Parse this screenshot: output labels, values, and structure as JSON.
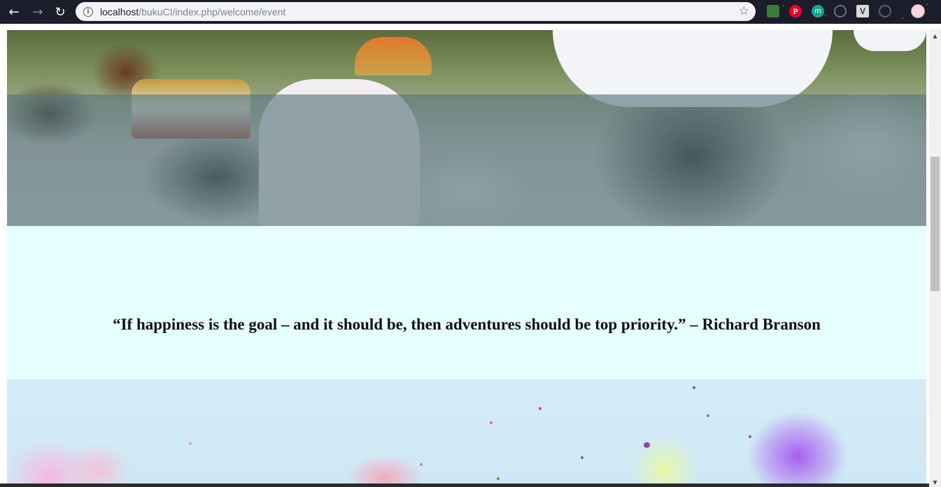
{
  "browser": {
    "url_host": "localhost",
    "url_path": "/bukuCI/index.php/welcome/event",
    "icons": {
      "back": "arrow-left-icon",
      "forward": "arrow-right-icon",
      "reload": "reload-icon",
      "site_info": "info-icon",
      "bookmark": "star-icon"
    },
    "extensions": {
      "pinterest_label": "P",
      "m_label": "m",
      "v_label": "V"
    }
  },
  "page": {
    "quote": "“If happiness is the goal – and it should be, then adventures should be top priority.” – Richard Branson"
  },
  "colors": {
    "quote_bg": "#e6ffff",
    "overlay": "rgba(90, 120, 128, 0.65)"
  }
}
